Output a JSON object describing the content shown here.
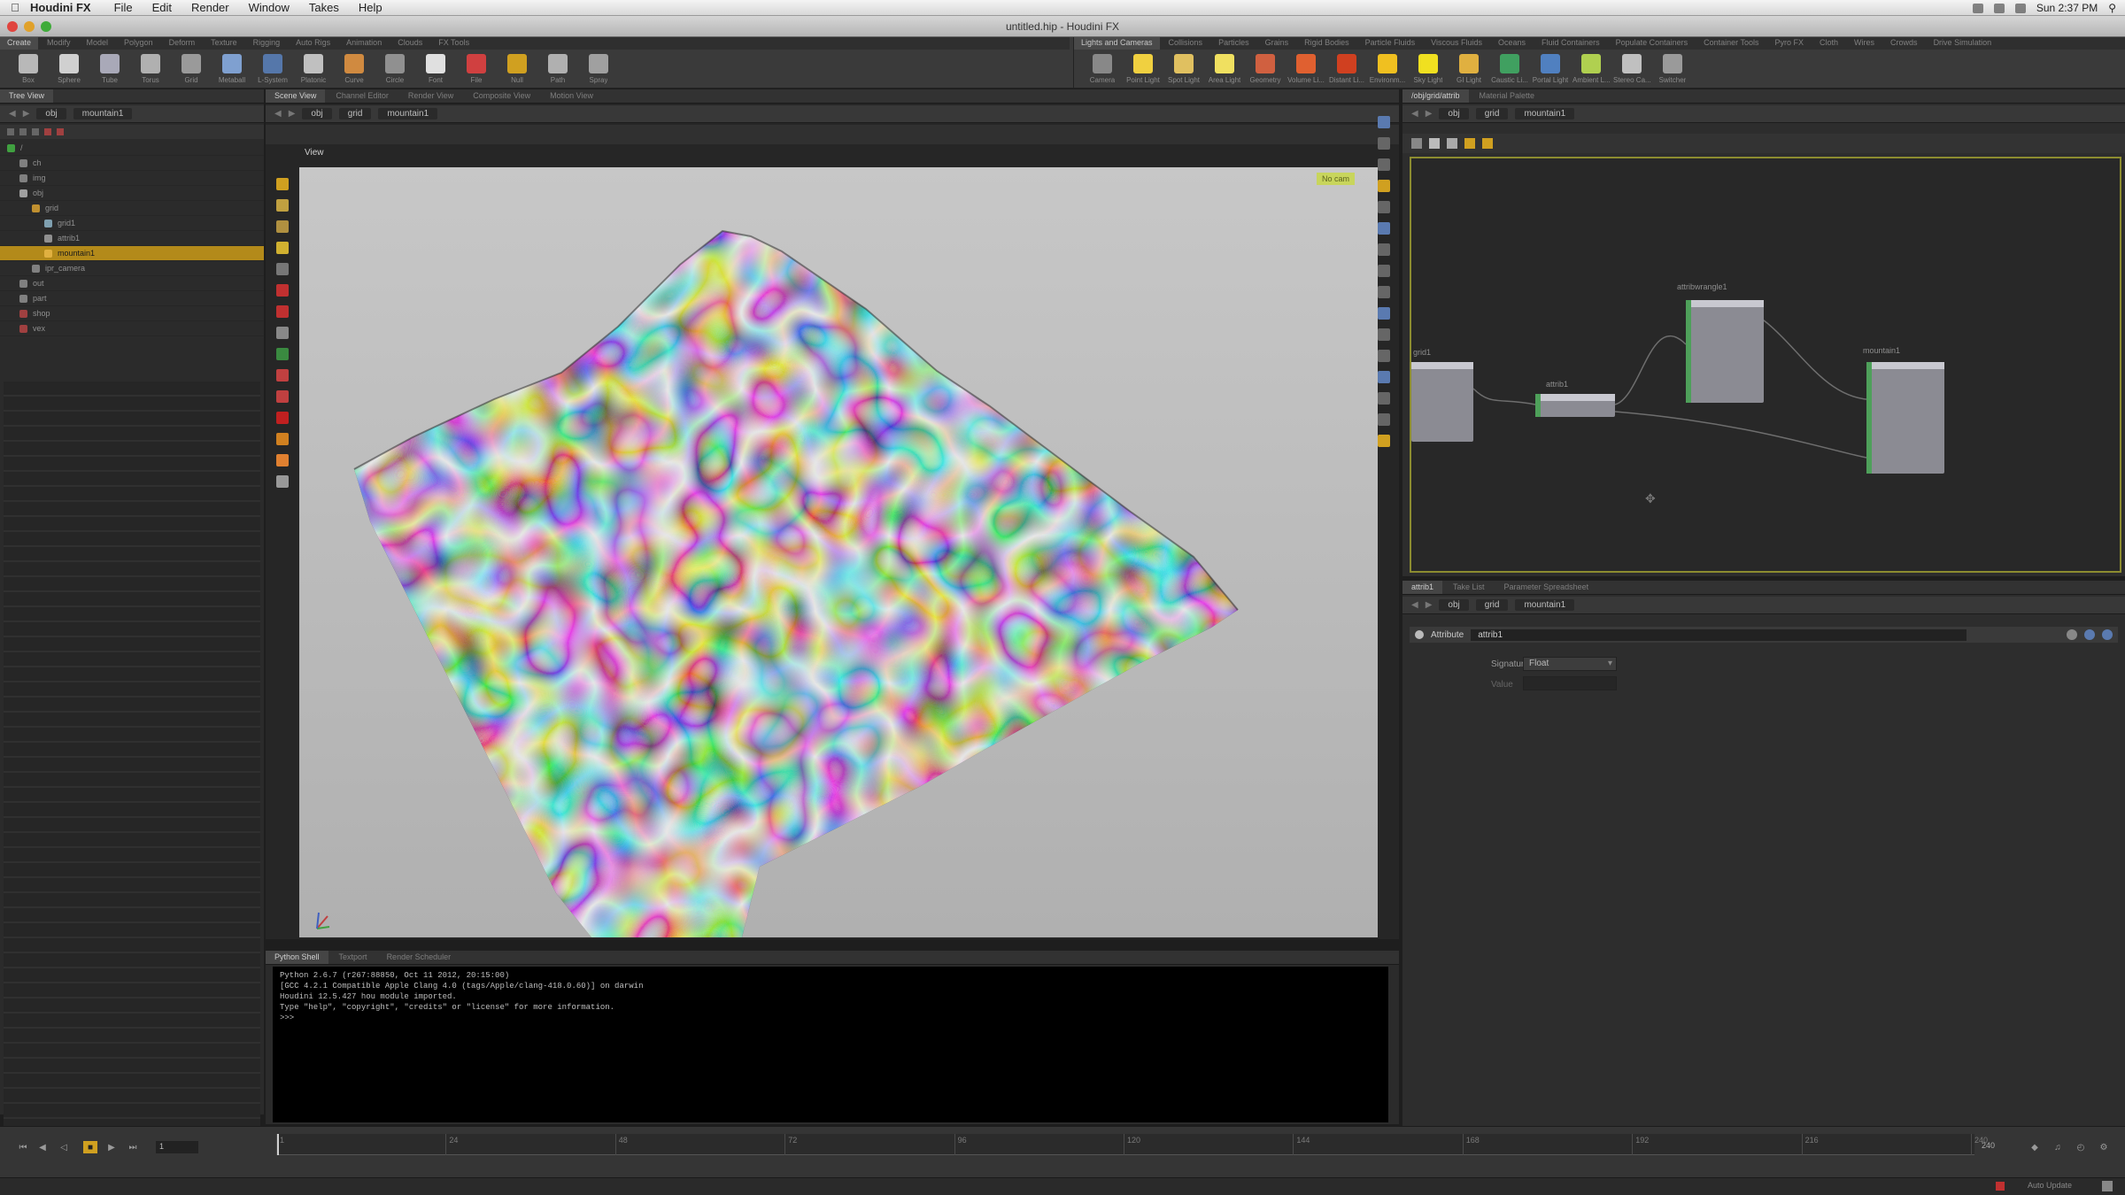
{
  "menubar": {
    "app_name": "Houdini FX",
    "menus": [
      "File",
      "Edit",
      "Render",
      "Window",
      "Takes",
      "Help"
    ],
    "clock": "Sun 2:37 PM"
  },
  "window": {
    "title": "untitled.hip - Houdini FX"
  },
  "shelf": {
    "left_tabs": [
      "Create",
      "Modify",
      "Model",
      "Polygon",
      "Deform",
      "Texture",
      "Rigging",
      "Auto Rigs",
      "Animation",
      "Clouds",
      "FX Tools"
    ],
    "right_tabs": [
      "Lights and Cameras",
      "Collisions",
      "Particles",
      "Grains",
      "Rigid Bodies",
      "Particle Fluids",
      "Viscous Fluids",
      "Oceans",
      "Fluid Containers",
      "Populate Containers",
      "Container Tools",
      "Pyro FX",
      "Cloth",
      "Wires",
      "Crowds",
      "Drive Simulation"
    ],
    "left_tools": [
      {
        "label": "Box",
        "color": "#b8b8b8"
      },
      {
        "label": "Sphere",
        "color": "#d0d0d0"
      },
      {
        "label": "Tube",
        "color": "#a9a9b8"
      },
      {
        "label": "Torus",
        "color": "#b0b0b0"
      },
      {
        "label": "Grid",
        "color": "#9a9a9a"
      },
      {
        "label": "Metaball",
        "color": "#7fa0d0"
      },
      {
        "label": "L-System",
        "color": "#5577aa"
      },
      {
        "label": "Platonic",
        "color": "#c0c0c0"
      },
      {
        "label": "Curve",
        "color": "#d08a40"
      },
      {
        "label": "Circle",
        "color": "#909090"
      },
      {
        "label": "Font",
        "color": "#e0e0e0"
      },
      {
        "label": "File",
        "color": "#d04040"
      },
      {
        "label": "Null",
        "color": "#d0a020"
      },
      {
        "label": "Path",
        "color": "#b0b0b0"
      },
      {
        "label": "Spray",
        "color": "#a0a0a0"
      }
    ],
    "right_tools": [
      {
        "label": "Camera",
        "color": "#888888"
      },
      {
        "label": "Point Light",
        "color": "#f0d040"
      },
      {
        "label": "Spot Light",
        "color": "#e0c060"
      },
      {
        "label": "Area Light",
        "color": "#f0e060"
      },
      {
        "label": "Geometry",
        "color": "#d06040"
      },
      {
        "label": "Volume Li...",
        "color": "#e06030"
      },
      {
        "label": "Distant Li...",
        "color": "#d04020"
      },
      {
        "label": "Environm...",
        "color": "#f0c020"
      },
      {
        "label": "Sky Light",
        "color": "#f0e020"
      },
      {
        "label": "GI Light",
        "color": "#e0b040"
      },
      {
        "label": "Caustic Li...",
        "color": "#40a060"
      },
      {
        "label": "Portal Light",
        "color": "#5080c0"
      },
      {
        "label": "Ambient L...",
        "color": "#b0d050"
      },
      {
        "label": "Stereo Ca...",
        "color": "#c0c0c0"
      },
      {
        "label": "Switcher",
        "color": "#9a9a9a"
      }
    ]
  },
  "tree": {
    "tabs": [
      "Tree View"
    ],
    "path": "obj",
    "path_node": "mountain1",
    "rows": [
      {
        "label": "/",
        "depth": 0,
        "color": "#40a040"
      },
      {
        "label": "ch",
        "depth": 1,
        "color": "#808080"
      },
      {
        "label": "img",
        "depth": 1,
        "color": "#808080"
      },
      {
        "label": "obj",
        "depth": 1,
        "color": "#a0a0a0"
      },
      {
        "label": "grid",
        "depth": 2,
        "color": "#c09030"
      },
      {
        "label": "grid1",
        "depth": 3,
        "color": "#7fa0b0"
      },
      {
        "label": "attrib1",
        "depth": 3,
        "color": "#909090"
      },
      {
        "label": "mountain1",
        "depth": 3,
        "color": "#e0b040",
        "selected": true
      },
      {
        "label": "ipr_camera",
        "depth": 2,
        "color": "#808080"
      },
      {
        "label": "out",
        "depth": 1,
        "color": "#808080"
      },
      {
        "label": "part",
        "depth": 1,
        "color": "#808080"
      },
      {
        "label": "shop",
        "depth": 1,
        "color": "#a04040"
      },
      {
        "label": "vex",
        "depth": 1,
        "color": "#a04040"
      }
    ]
  },
  "scene": {
    "tabs": [
      "Scene View",
      "Channel Editor",
      "Render View",
      "Composite View",
      "Motion View"
    ],
    "path": "obj",
    "path_node": "grid",
    "path_node2": "mountain1",
    "viewport_label": "View",
    "camera_label": "No cam"
  },
  "network": {
    "tabs": [
      "/obj/grid/attrib",
      "Material Palette"
    ],
    "path": "obj",
    "path_node": "grid",
    "path_node2": "mountain1",
    "nodes": [
      {
        "label": "grid1"
      },
      {
        "label": "attrib1"
      },
      {
        "label": "attribwrangle1"
      },
      {
        "label": "mountain1"
      }
    ]
  },
  "params": {
    "tabs": [
      "attrib1",
      "Take List",
      "Parameter Spreadsheet"
    ],
    "path": "obj",
    "path_node": "grid",
    "path_node2": "mountain1",
    "node_type": "Attribute",
    "node_name": "attrib1",
    "fields": [
      {
        "label": "Signature",
        "value": "Float"
      },
      {
        "label": "Value",
        "value": ""
      }
    ]
  },
  "shell": {
    "tabs": [
      "Python Shell",
      "Textport",
      "Render Scheduler"
    ],
    "lines": [
      "Python 2.6.7 (r267:88850, Oct 11 2012, 20:15:00)",
      "[GCC 4.2.1 Compatible Apple Clang 4.0 (tags/Apple/clang-418.0.60)] on darwin",
      "Houdini 12.5.427 hou module imported.",
      "Type \"help\", \"copyright\", \"credits\" or \"license\" for more information.",
      ">>>"
    ]
  },
  "timeline": {
    "frame": "1",
    "end": "240",
    "ticks": [
      "1",
      "24",
      "48",
      "72",
      "96",
      "120",
      "144",
      "168",
      "192",
      "216",
      "240"
    ]
  },
  "status": {
    "text": "Auto Update"
  },
  "colors": {
    "accent": "#b38a1a",
    "network_border": "#8c8c30",
    "node_flag": "#4ea05a"
  }
}
